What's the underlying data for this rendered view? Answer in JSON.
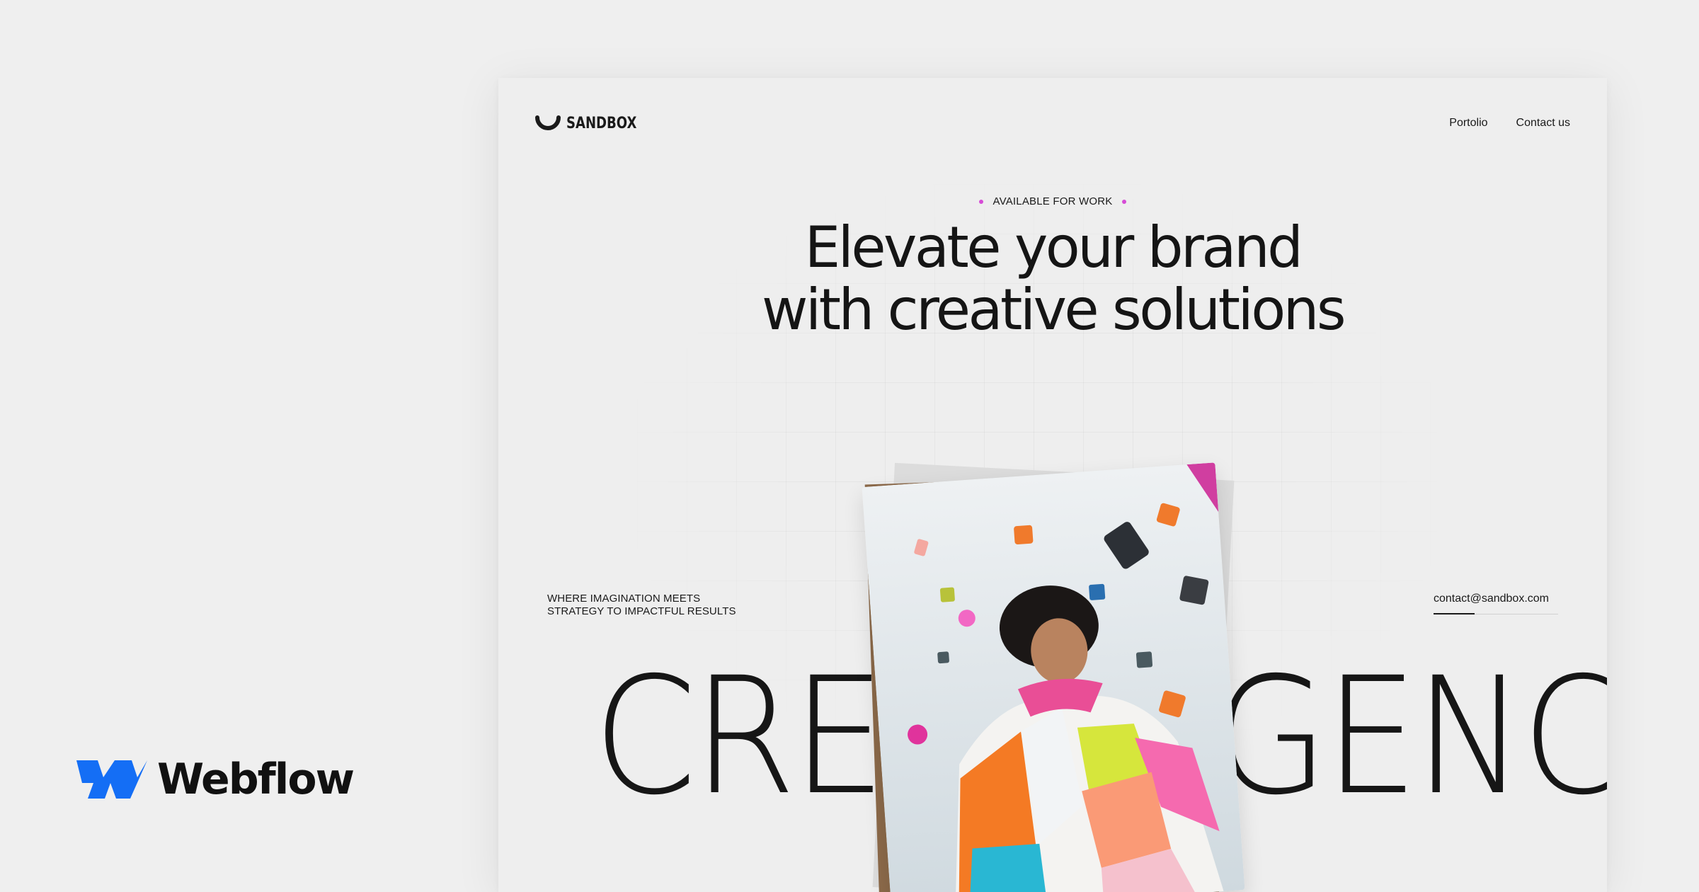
{
  "brand": {
    "name": "Webflow",
    "color": "#146ef5"
  },
  "site": {
    "logo_text": "SANDBOX",
    "nav": {
      "links": [
        "Portolio",
        "Contact us"
      ]
    },
    "hero": {
      "status": "AVAILABLE FOR WORK",
      "status_dot_color": "#d64bd6",
      "headline_line1": "Elevate your brand",
      "headline_line2": "with creative solutions",
      "tagline_line1": "WHERE IMAGINATION MEETS",
      "tagline_line2": "STRATEGY TO IMPACTFUL RESULTS",
      "contact_email": "contact@sandbox.com",
      "marquee_left": "CREAT",
      "marquee_right": "GENC"
    }
  },
  "icons": {
    "logo": "smile-arc-icon",
    "brand": "webflow-logo-icon"
  }
}
